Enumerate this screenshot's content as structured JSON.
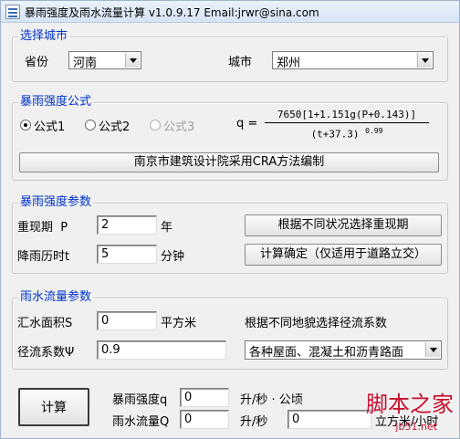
{
  "window": {
    "title": "暴雨强度及雨水流量计算 v1.0.9.17 Email:jrwr@sina.com"
  },
  "city": {
    "legend": "选择城市",
    "province_label": "省份",
    "province_value": "河南",
    "city_label": "城市",
    "city_value": "郑州"
  },
  "formula": {
    "legend": "暴雨强度公式",
    "options": [
      "公式1",
      "公式2",
      "公式3"
    ],
    "selected": "公式1",
    "lhs": "q =",
    "numerator": "7650[1+1.151g(P+0.143)]",
    "denominator": "(t+37.3)",
    "exponent": "0.99",
    "source": "南京市建筑设计院采用CRA方法编制"
  },
  "params": {
    "legend": "暴雨强度参数",
    "period_label": "重现期  P",
    "period_value": "2",
    "period_unit": "年",
    "duration_label": "降雨历时t",
    "duration_value": "5",
    "duration_unit": "分钟",
    "choose_period_button": "根据不同状况选择重现期",
    "confirm_button": "计算确定（仅适用于道路立交）"
  },
  "flow": {
    "legend": "雨水流量参数",
    "area_label": "汇水面积S",
    "area_value": "0",
    "area_unit": "平方米",
    "coef_hint": "根据不同地貌选择径流系数",
    "coef_label": "径流系数Ψ",
    "coef_value": "0.9",
    "surface_value": "各种屋面、混凝土和沥青路面"
  },
  "result": {
    "calc_button": "计算",
    "intensity_label": "暴雨强度q",
    "intensity_value": "0",
    "intensity_unit": "升/秒 · 公顷",
    "flow_label": "雨水流量Q",
    "flow_value": "0",
    "flow_unit": "升/秒",
    "flow_m3_value": "0",
    "flow_m3_unit": "立方米/小时"
  },
  "watermark": {
    "text": "脚本之家",
    "sub": "jb51.net"
  },
  "icons": {
    "app": "app-icon",
    "dropdown": "chevron-down-icon"
  }
}
